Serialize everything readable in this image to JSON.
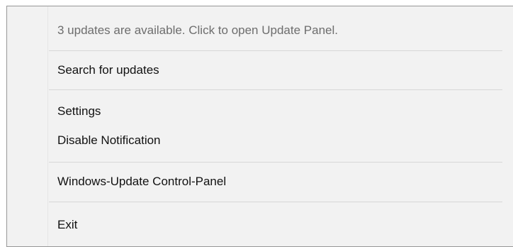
{
  "menu": {
    "items": [
      {
        "label": "3 updates are available. Click to open Update Panel.",
        "enabled": false
      },
      {
        "label": "Search for updates",
        "enabled": true
      },
      {
        "label": "Settings",
        "enabled": true
      },
      {
        "label": "Disable Notification",
        "enabled": true
      },
      {
        "label": "Windows-Update Control-Panel",
        "enabled": true
      },
      {
        "label": "Exit",
        "enabled": true
      }
    ]
  },
  "colors": {
    "menu_background": "#f2f2f2",
    "menu_border": "#979797",
    "separator": "#d7d7d7",
    "disabled_text": "#6d6d6d",
    "text": "#111111"
  }
}
